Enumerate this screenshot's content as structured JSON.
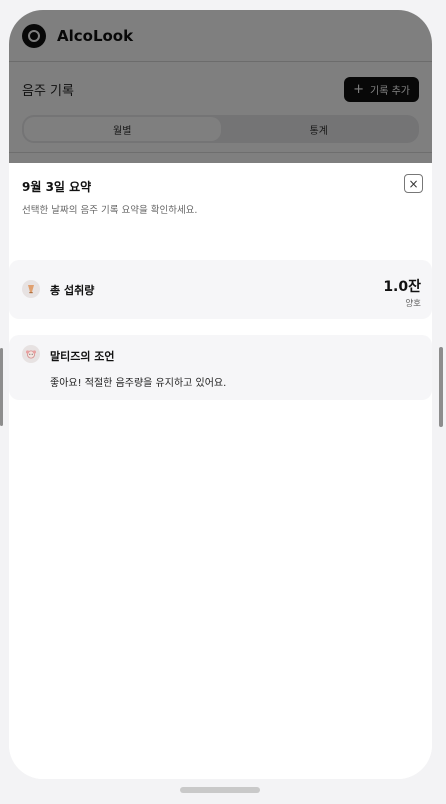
{
  "app": {
    "title": "AlcoLook",
    "section_title": "음주 기록",
    "add_button_label": "기록 추가",
    "tabs": [
      {
        "label": "월별",
        "active": true
      },
      {
        "label": "통계",
        "active": false
      }
    ]
  },
  "sheet": {
    "title": "9월 3일 요약",
    "subtitle": "선택한 날짜의 음주 기록 요약을 확인하세요.",
    "close_label": "×",
    "total": {
      "label": "총 섭취량",
      "value": "1.0잔",
      "status": "양호",
      "icon": "drink-icon"
    },
    "advice": {
      "label": "말티즈의 조언",
      "text": "좋아요! 적절한 음주량을 유지하고 있어요.",
      "icon": "dog-icon"
    }
  },
  "colors": {
    "accent": "#111111",
    "card_bg": "#f6f6f8",
    "overlay": "rgba(0,0,0,0.5)"
  }
}
